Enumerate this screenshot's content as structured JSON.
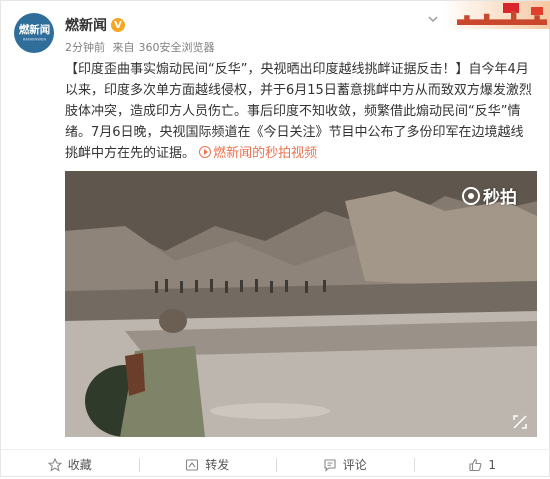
{
  "post": {
    "author": "燃新闻",
    "verified": "V",
    "time": "2分钟前",
    "source_prefix": "来自",
    "source": "360安全浏览器",
    "avatar_text": "燃新闻",
    "avatar_subtext": "RANXINWEN",
    "text_part1": "【印度歪曲事实煽动民间“反华”，央视晒出印度越线挑衅证据反击！】自今年4月以来，印度多次单方面越线侵权，并于6月15日蓄意挑衅中方从而致双方爆发激烈肢体冲突，造成印方人员伤亡。事后印度不知收敛，频繁借此煽动民间“反华”情绪。7月6日晚，央视国际频道在《今日关注》节目中公布了多份印军在边境越线挑衅中方在先的证据。",
    "video_link": "燃新闻的秒拍视频"
  },
  "video": {
    "watermark": "秒拍",
    "colors": {
      "sky": "#8a8076",
      "river": "#b9b3ad",
      "rocks": "#6d6257"
    }
  },
  "actions": [
    {
      "icon": "star-icon",
      "label": "收藏"
    },
    {
      "icon": "share-icon",
      "label": "转发"
    },
    {
      "icon": "comment-icon",
      "label": "评论"
    },
    {
      "icon": "like-icon",
      "label": "1"
    }
  ]
}
